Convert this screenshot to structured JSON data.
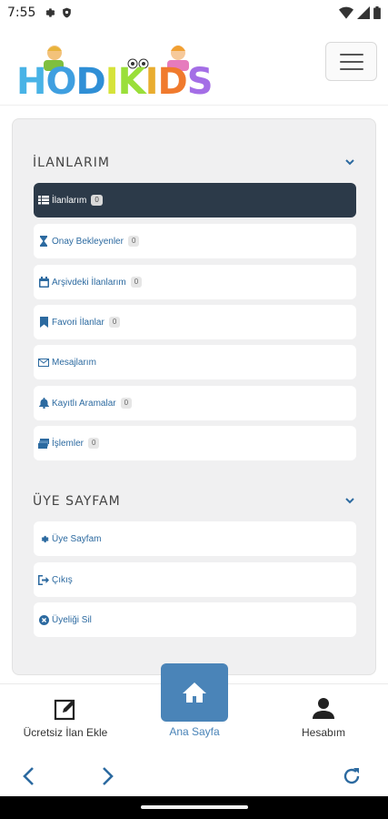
{
  "status_bar": {
    "time": "7:55",
    "icons": [
      "gear-icon",
      "shield-icon",
      "wifi-icon",
      "cellular-signal-icon",
      "battery-icon"
    ]
  },
  "header": {
    "logo_text": "HODIKIDS",
    "menu_icon": "hamburger-menu-icon"
  },
  "sections": [
    {
      "title": "İLANLARIM",
      "items": [
        {
          "label": "İlanlarım",
          "badge": "0",
          "icon": "table-list-icon",
          "active": true
        },
        {
          "label": "Onay Bekleyenler",
          "badge": "0",
          "icon": "hourglass-icon",
          "active": false
        },
        {
          "label": "Arşivdeki İlanlarım",
          "badge": "0",
          "icon": "calendar-icon",
          "active": false
        },
        {
          "label": "Favori İlanlar",
          "badge": "0",
          "icon": "bookmark-icon",
          "active": false
        },
        {
          "label": "Mesajlarım",
          "badge": "",
          "icon": "envelope-icon",
          "active": false
        },
        {
          "label": "Kayıtlı Aramalar",
          "badge": "0",
          "icon": "bell-icon",
          "active": false
        },
        {
          "label": "İşlemler",
          "badge": "0",
          "icon": "money-icon",
          "active": false
        }
      ]
    },
    {
      "title": "ÜYE SAYFAM",
      "items": [
        {
          "label": "Üye Sayfam",
          "icon": "gear-icon"
        },
        {
          "label": "Çıkış",
          "icon": "sign-out-icon"
        },
        {
          "label": "Üyeliği Sil",
          "icon": "circle-x-icon"
        }
      ]
    }
  ],
  "bottom_nav": {
    "add_listing": "Ücretsiz İlan Ekle",
    "home": "Ana Sayfa",
    "account": "Hesabım"
  },
  "browser_nav": {
    "icons": [
      "back-arrow-icon",
      "forward-arrow-icon",
      "refresh-icon"
    ]
  },
  "colors": {
    "accent": "#2c6aa0",
    "active_bg": "#2c3a49",
    "home_button": "#4a84b8",
    "panel_bg": "#f0f0f1"
  }
}
